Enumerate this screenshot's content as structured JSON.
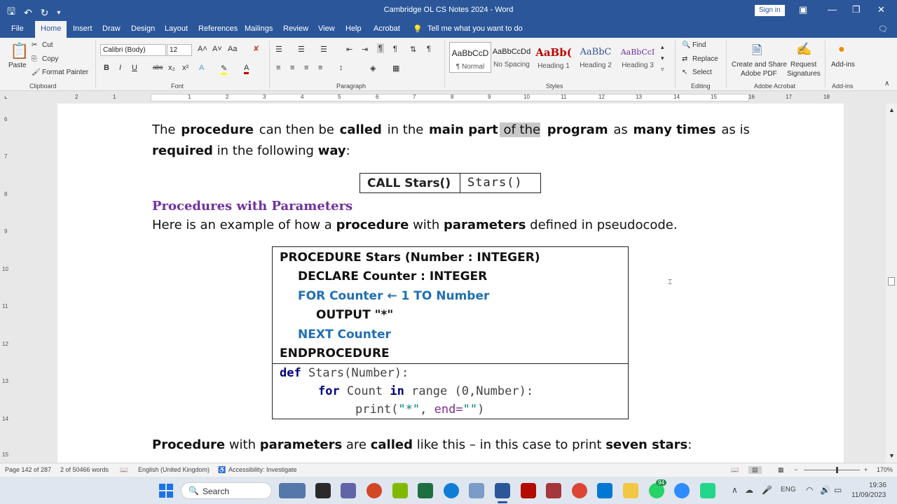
{
  "window": {
    "title": "Cambridge OL CS Notes 2024 - Word",
    "signin_label": "Sign in"
  },
  "tabs": [
    "File",
    "Home",
    "Insert",
    "Draw",
    "Design",
    "Layout",
    "References",
    "Mailings",
    "Review",
    "View",
    "Help",
    "Acrobat"
  ],
  "tell_me": "Tell me what you want to do",
  "ribbon": {
    "clipboard": {
      "paste": "Paste",
      "cut": "Cut",
      "copy": "Copy",
      "format_painter": "Format Painter",
      "label": "Clipboard"
    },
    "font": {
      "name": "Calibri (Body)",
      "size": "12",
      "label": "Font"
    },
    "paragraph": {
      "label": "Paragraph"
    },
    "styles": {
      "items": [
        {
          "preview": "AaBbCcD",
          "name": "¶ Normal"
        },
        {
          "preview": "AaBbCcDd",
          "name": "No Spacing"
        },
        {
          "preview": "AaBb(",
          "name": "Heading 1"
        },
        {
          "preview": "AaBbC",
          "name": "Heading 2"
        },
        {
          "preview": "AaBbCcI",
          "name": "Heading 3"
        }
      ],
      "label": "Styles"
    },
    "editing": {
      "find": "Find",
      "replace": "Replace",
      "select": "Select",
      "label": "Editing"
    },
    "acrobat": {
      "create": "Create and Share",
      "create2": "Adobe PDF",
      "request": "Request",
      "request2": "Signatures",
      "label": "Adobe Acrobat"
    },
    "addins": {
      "btn": "Add-ins",
      "label": "Add-ins"
    }
  },
  "ruler_numbers": [
    "2",
    "1",
    "1",
    "2",
    "3",
    "4",
    "5",
    "6",
    "7",
    "8",
    "9",
    "10",
    "11",
    "12",
    "13",
    "14",
    "15",
    "16",
    "17",
    "18"
  ],
  "vruler_numbers": [
    "6",
    "7",
    "8",
    "9",
    "10",
    "11",
    "12",
    "13",
    "14",
    "15"
  ],
  "document": {
    "p1_line1": [
      {
        "t": "The ",
        "b": false
      },
      {
        "t": "procedure",
        "b": true
      },
      {
        "t": " can then be ",
        "b": false
      },
      {
        "t": "called",
        "b": true
      },
      {
        "t": " in the ",
        "b": false
      },
      {
        "t": "main part",
        "b": true
      },
      {
        "t": " of the",
        "b": false,
        "hl": true
      },
      {
        "t": " ",
        "b": false
      },
      {
        "t": "program",
        "b": true
      },
      {
        "t": " as ",
        "b": false
      },
      {
        "t": "many times",
        "b": true
      },
      {
        "t": " as is",
        "b": false
      }
    ],
    "p1_line2": [
      {
        "t": "required",
        "b": true
      },
      {
        "t": " in the following ",
        "b": false
      },
      {
        "t": "way",
        "b": true
      },
      {
        "t": ":",
        "b": false
      }
    ],
    "call_table": {
      "pseudo": "CALL Stars()",
      "python": "Stars()"
    },
    "heading": "Procedures with Parameters",
    "p2": [
      {
        "t": "Here is an example of how a ",
        "b": false
      },
      {
        "t": "procedure",
        "b": true
      },
      {
        "t": " with ",
        "b": false
      },
      {
        "t": "parameters",
        "b": true
      },
      {
        "t": " defined in pseudocode.",
        "b": false
      }
    ],
    "pseudocode": [
      "PROCEDURE Stars (Number : INTEGER)",
      "DECLARE Counter : INTEGER",
      "FOR Counter ← 1 TO Number",
      "OUTPUT \"*\"",
      "NEXT Counter",
      "ENDPROCEDURE"
    ],
    "python": {
      "l1_kw": "def",
      "l1_rest": " Stars(Number):",
      "l2_kw": "for",
      "l2_a": " Count ",
      "l2_kw2": "in",
      "l2_b": " range (0,Number):",
      "l3_a": "print(",
      "l3_str": "\"*\"",
      "l3_b": ", ",
      "l3_par": "end=",
      "l3_str2": "\"\"",
      "l3_c": ")"
    },
    "p3": [
      {
        "t": "Procedure",
        "b": true
      },
      {
        "t": " with ",
        "b": false
      },
      {
        "t": "parameters",
        "b": true
      },
      {
        "t": " are ",
        "b": false
      },
      {
        "t": "called",
        "b": true
      },
      {
        "t": " like this – in this case to print ",
        "b": false
      },
      {
        "t": "seven stars",
        "b": true
      },
      {
        "t": ":",
        "b": false
      }
    ]
  },
  "status": {
    "page": "Page 142 of 287",
    "words": "2 of 50466 words",
    "language": "English (United Kingdom)",
    "accessibility": "Accessibility: Investigate",
    "zoom": "170%"
  },
  "taskbar": {
    "search": "Search",
    "badge": "94",
    "lang": "ENG",
    "time": "19:36",
    "date": "11/09/2023"
  },
  "colors": {
    "word_blue": "#2b579a",
    "heading_purple": "#7030a0",
    "pseudo_blue": "#1f6fb5"
  }
}
